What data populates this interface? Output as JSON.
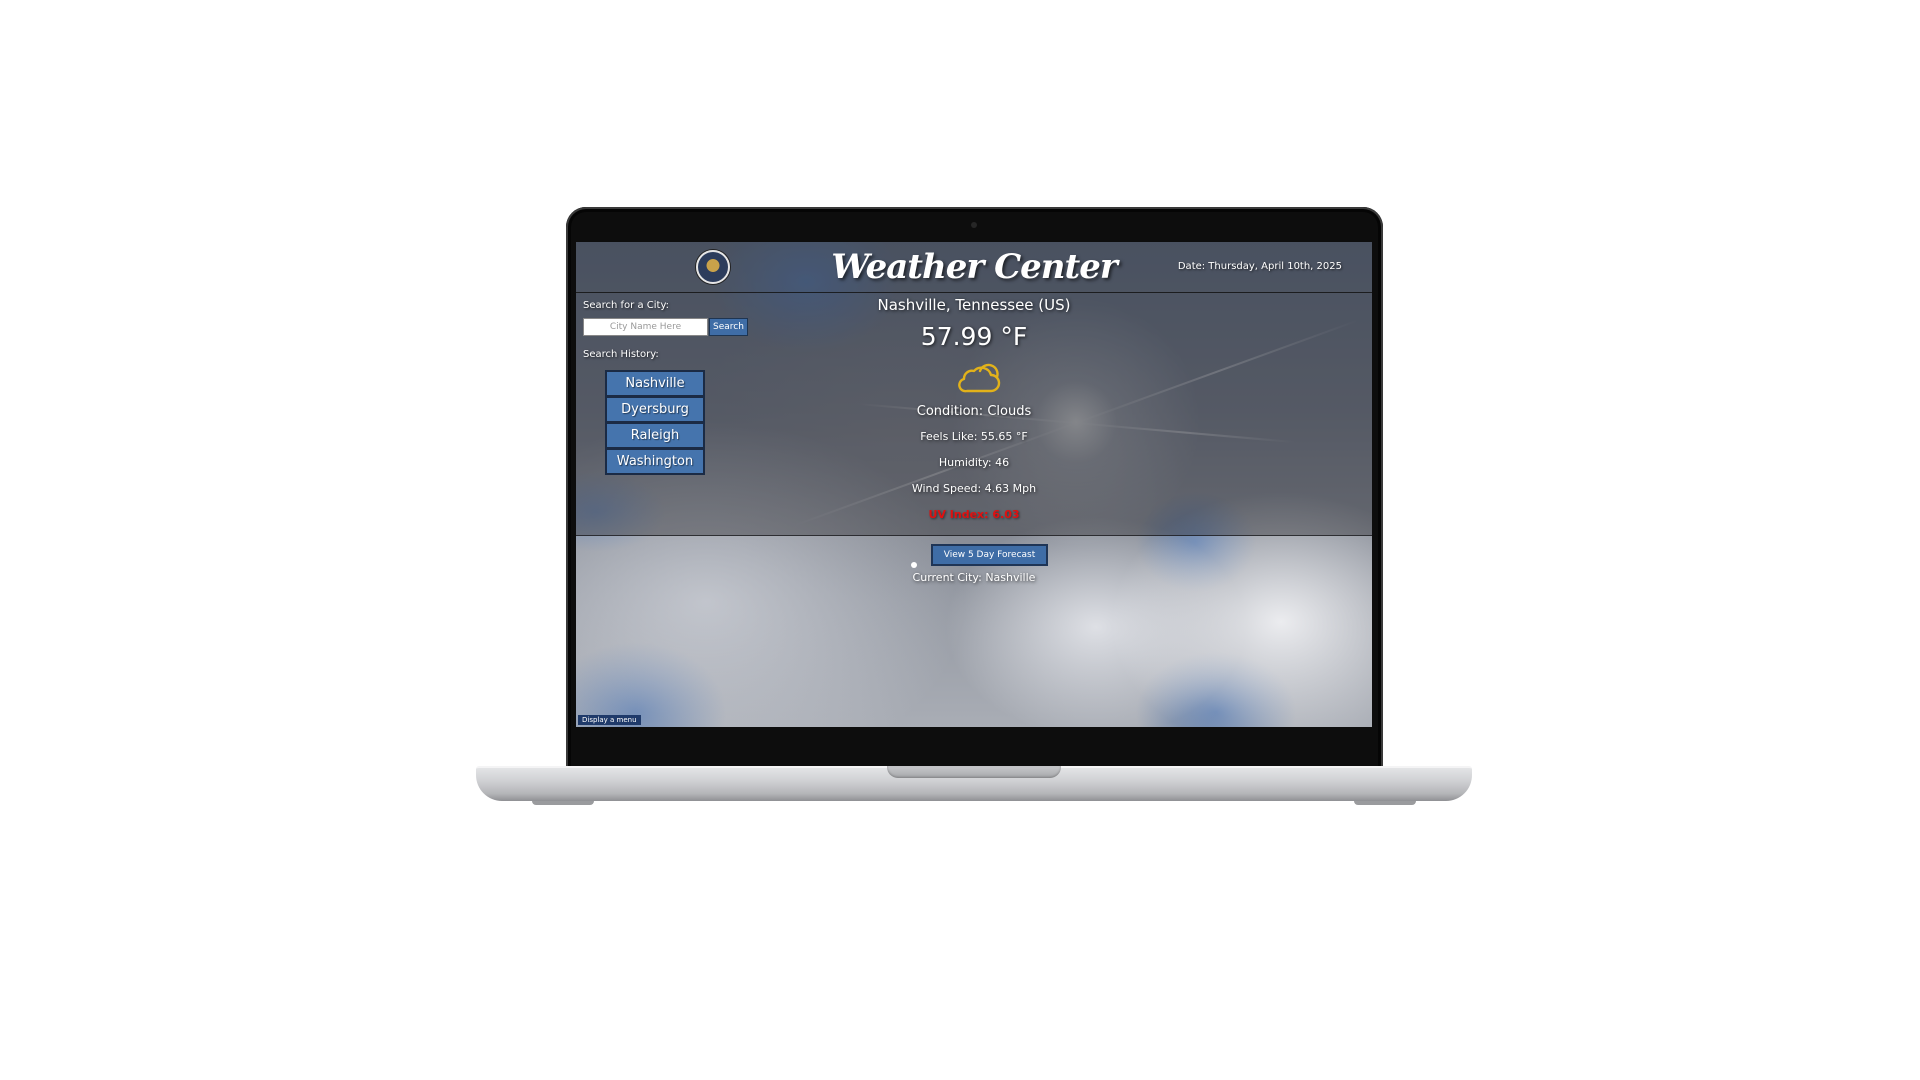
{
  "header": {
    "title": "Weather Center",
    "date": "Date: Thursday, April 10th, 2025"
  },
  "search": {
    "label": "Search for a City:",
    "placeholder": "City Name Here",
    "value": "",
    "button_label": "Search"
  },
  "history": {
    "label": "Search History:",
    "items": [
      {
        "label": "Nashville"
      },
      {
        "label": "Dyersburg"
      },
      {
        "label": "Raleigh"
      },
      {
        "label": "Washington"
      }
    ]
  },
  "weather": {
    "location": "Nashville, Tennessee (US)",
    "temperature": "57.99 °F",
    "icon": "cloud-icon",
    "icon_color": "#e2b21a",
    "condition": "Condition: Clouds",
    "feels_like": "Feels Like: 55.65 °F",
    "humidity": "Humidity: 46",
    "wind_speed": "Wind Speed: 4.63 Mph",
    "uv_index": "UV Index: 6.03",
    "uv_color": "#e01010"
  },
  "forecast": {
    "button_label": "View 5 Day Forecast",
    "current_city": "Current City: Nashville"
  },
  "menu_chip": "Display a menu",
  "colors": {
    "button_blue": "#4574ad",
    "accent_blue": "#3f6da6"
  }
}
